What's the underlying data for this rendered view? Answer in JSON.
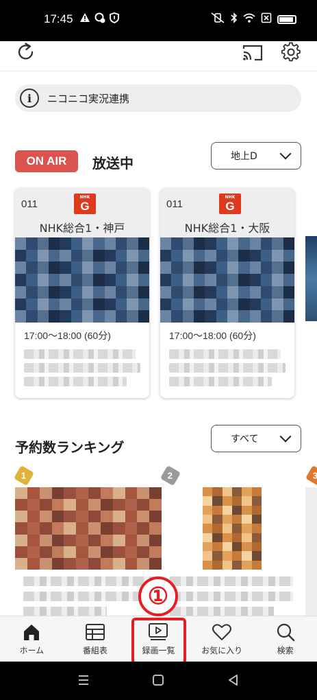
{
  "status_bar": {
    "time": "17:45",
    "left_icons": [
      "warning-icon",
      "settings-badge-icon",
      "shield-icon"
    ],
    "right_icons": [
      "mute-vibrate-icon",
      "bluetooth-icon",
      "wifi-icon",
      "no-sim-icon",
      "battery-icon"
    ]
  },
  "header": {
    "refresh_icon": "refresh-icon",
    "cast_icon": "cast-icon",
    "settings_icon": "gear-icon"
  },
  "nico_banner": {
    "text": "ニコニコ実況連携"
  },
  "onair": {
    "badge": "ON AIR",
    "title": "放送中",
    "area_select": "地上D"
  },
  "channels": [
    {
      "number": "011",
      "logo_small": "NHK",
      "logo_big": "G",
      "name": "NHK総合1・神戸",
      "time": "17:00〜18:00 (60分)"
    },
    {
      "number": "011",
      "logo_small": "NHK",
      "logo_big": "G",
      "name": "NHK総合1・大阪",
      "time": "17:00〜18:00 (60分)"
    }
  ],
  "ranking": {
    "title": "予約数ランキング",
    "sort_select": "すべて",
    "ranks": [
      "1",
      "2",
      "3"
    ]
  },
  "annotation": {
    "marker": "①"
  },
  "bottom_nav": {
    "items": [
      {
        "label": "ホーム",
        "icon": "home-icon"
      },
      {
        "label": "番組表",
        "icon": "tv-guide-icon"
      },
      {
        "label": "録画一覧",
        "icon": "recordings-icon"
      },
      {
        "label": "お気に入り",
        "icon": "heart-icon"
      },
      {
        "label": "検索",
        "icon": "search-icon"
      }
    ]
  },
  "colors": {
    "onair_badge": "#d9534f",
    "nhk_logo": "#e03a1e",
    "annotation": "#e31e24",
    "rank_gold": "#e0b23a",
    "rank_silver": "#9a9a9a",
    "rank_bronze": "#e07a2a"
  }
}
